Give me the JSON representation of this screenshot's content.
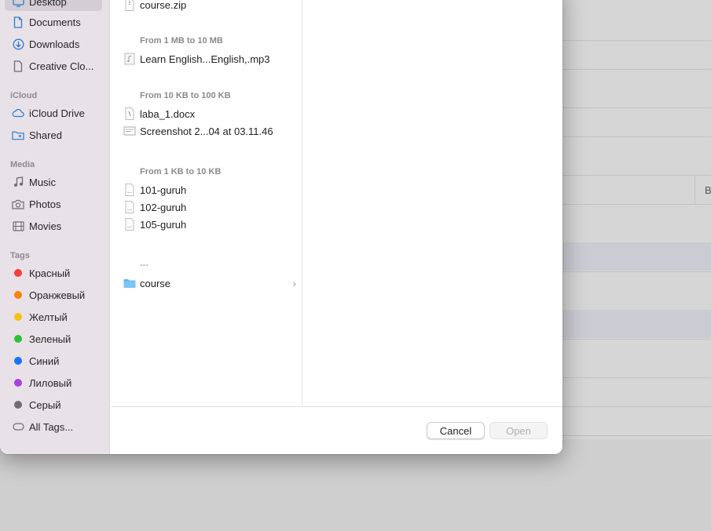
{
  "sidebar": {
    "favorites": [
      {
        "label": "Desktop",
        "icon": "desktop-icon",
        "selected": true
      },
      {
        "label": "Documents",
        "icon": "document-icon"
      },
      {
        "label": "Downloads",
        "icon": "download-icon"
      },
      {
        "label": "Creative Clo...",
        "icon": "file-icon"
      }
    ],
    "icloud_header": "iCloud",
    "icloud": [
      {
        "label": "iCloud Drive",
        "icon": "cloud-icon"
      },
      {
        "label": "Shared",
        "icon": "shared-folder-icon"
      }
    ],
    "media_header": "Media",
    "media": [
      {
        "label": "Music",
        "icon": "music-note-icon"
      },
      {
        "label": "Photos",
        "icon": "camera-icon"
      },
      {
        "label": "Movies",
        "icon": "film-icon"
      }
    ],
    "tags_header": "Tags",
    "tags": [
      {
        "label": "Красный",
        "color": "#f0413b"
      },
      {
        "label": "Оранжевый",
        "color": "#f5850f"
      },
      {
        "label": "Желтый",
        "color": "#f4c20f"
      },
      {
        "label": "Зеленый",
        "color": "#2fbf3a"
      },
      {
        "label": "Синий",
        "color": "#1a72f0"
      },
      {
        "label": "Лиловый",
        "color": "#a443d9"
      },
      {
        "label": "Серый",
        "color": "#6e6e70"
      }
    ],
    "all_tags": "All Tags..."
  },
  "files": {
    "top_file": "course.zip",
    "group1_header": "From 1 MB to 10 MB",
    "group1": [
      "Learn English...English,.mp3"
    ],
    "group2_header": "From 10 KB to 100 KB",
    "group2": [
      "laba_1.docx",
      "Screenshot 2...04 at 03.11.46"
    ],
    "group3_header": "From 1 KB to 10 KB",
    "group3": [
      "101-guruh",
      "102-guruh",
      "105-guruh"
    ],
    "group4_header": "---",
    "group4": [
      "course"
    ]
  },
  "footer": {
    "cancel_label": "Cancel",
    "open_label": "Open"
  },
  "background": {
    "cell_text": "B"
  }
}
